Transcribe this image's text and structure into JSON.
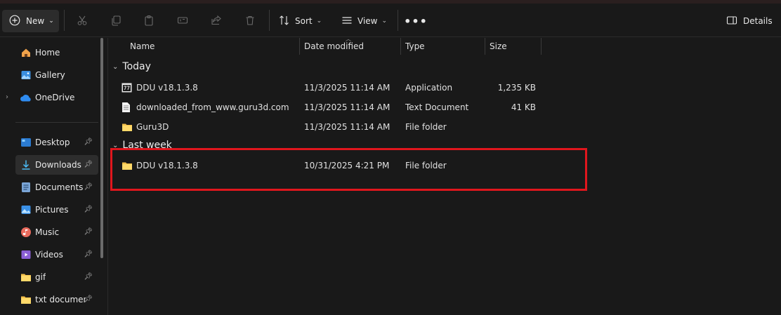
{
  "toolbar": {
    "new_label": "New",
    "sort_label": "Sort",
    "view_label": "View",
    "more_label": "•••",
    "details_label": "Details",
    "icons": [
      "cut-icon",
      "copy-icon",
      "paste-icon",
      "rename-icon",
      "share-icon",
      "delete-icon"
    ]
  },
  "sidebar": {
    "top_items": [
      {
        "label": "Home",
        "icon": "home-icon"
      },
      {
        "label": "Gallery",
        "icon": "gallery-icon"
      },
      {
        "label": "OneDrive",
        "icon": "onedrive-icon"
      }
    ],
    "pinned_items": [
      {
        "label": "Desktop",
        "icon": "desktop-icon",
        "selected": false
      },
      {
        "label": "Downloads",
        "icon": "downloads-icon",
        "selected": true
      },
      {
        "label": "Documents",
        "icon": "documents-icon",
        "selected": false
      },
      {
        "label": "Pictures",
        "icon": "pictures-icon",
        "selected": false
      },
      {
        "label": "Music",
        "icon": "music-icon",
        "selected": false
      },
      {
        "label": "Videos",
        "icon": "videos-icon",
        "selected": false
      },
      {
        "label": "gif",
        "icon": "folder-icon",
        "selected": false
      },
      {
        "label": "txt documen",
        "icon": "folder-icon",
        "selected": false
      }
    ]
  },
  "columns": {
    "name": "Name",
    "date": "Date modified",
    "type": "Type",
    "size": "Size"
  },
  "groups": [
    {
      "label": "Today",
      "rows": [
        {
          "name": "DDU v18.1.3.8",
          "date": "11/3/2025 11:14 AM",
          "type": "Application",
          "size": "1,235 KB",
          "icon": "app-icon"
        },
        {
          "name": "downloaded_from_www.guru3d.com",
          "date": "11/3/2025 11:14 AM",
          "type": "Text Document",
          "size": "41 KB",
          "icon": "text-file-icon"
        },
        {
          "name": "Guru3D",
          "date": "11/3/2025 11:14 AM",
          "type": "File folder",
          "size": "",
          "icon": "folder-icon"
        }
      ]
    },
    {
      "label": "Last week",
      "rows": [
        {
          "name": "DDU v18.1.3.8",
          "date": "10/31/2025 4:21 PM",
          "type": "File folder",
          "size": "",
          "icon": "folder-icon"
        }
      ]
    }
  ],
  "colors": {
    "background": "#191919",
    "highlight": "#e0161d",
    "folder": "#f4c04a",
    "accent": "#4cc2ff"
  }
}
